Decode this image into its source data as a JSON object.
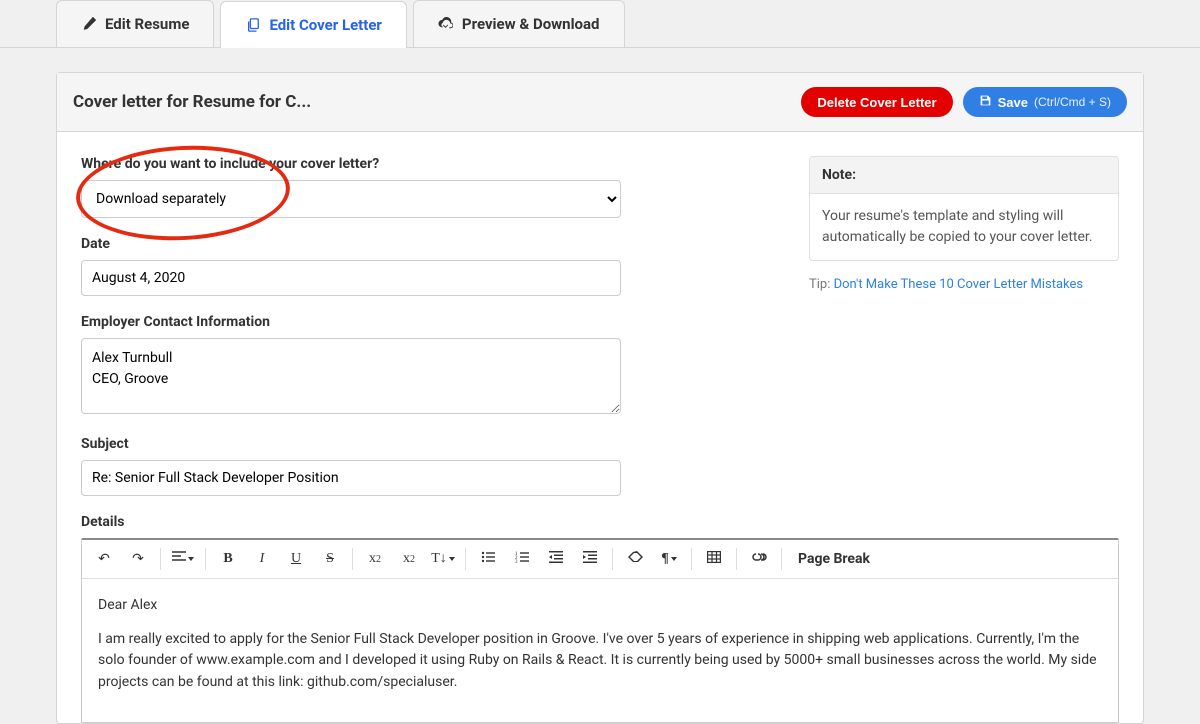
{
  "tabs": {
    "resume": "Edit Resume",
    "cover": "Edit Cover Letter",
    "preview": "Preview & Download"
  },
  "header": {
    "title": "Cover letter for Resume for C...",
    "delete": "Delete Cover Letter",
    "save": "Save",
    "save_shortcut": "(Ctrl/Cmd + S)"
  },
  "form": {
    "include_label": "Where do you want to include your cover letter?",
    "include_value": "Download separately",
    "date_label": "Date",
    "date_value": "August 4, 2020",
    "employer_label": "Employer Contact Information",
    "employer_value": "Alex Turnbull\nCEO, Groove",
    "subject_label": "Subject",
    "subject_value": "Re: Senior Full Stack Developer Position",
    "details_label": "Details"
  },
  "sidebar": {
    "note_title": "Note:",
    "note_body": "Your resume's template and styling will automatically be copied to your cover letter.",
    "tip_prefix": "Tip: ",
    "tip_link": "Don't Make These 10 Cover Letter Mistakes"
  },
  "toolbar": {
    "page_break": "Page Break"
  },
  "editor": {
    "greeting": "Dear Alex",
    "para1": "I am really excited to apply for the Senior Full Stack Developer position in Groove. I've over 5 years of experience in shipping web applications. Currently, I'm the solo founder of www.example.com and I developed it using Ruby on Rails & React. It is currently being used by 5000+ small businesses across the world. My side projects can be found at this link: github.com/specialuser."
  }
}
